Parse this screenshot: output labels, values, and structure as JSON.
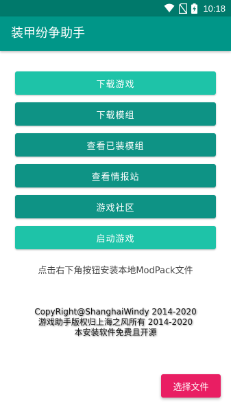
{
  "status_bar": {
    "time": "10:18",
    "icons": [
      "wifi-icon",
      "no-sim-icon",
      "battery-charging-icon"
    ],
    "color": "#00796b"
  },
  "app_bar": {
    "title": "装甲纷争助手",
    "color": "#009688"
  },
  "menu": {
    "download_game": "下载游戏",
    "download_mod": "下载模组",
    "view_installed_mods": "查看已装模组",
    "view_intel_station": "查看情报站",
    "game_community": "游戏社区",
    "launch_game": "启动游戏"
  },
  "hint": "点击右下角按钮安装本地ModPack文件",
  "copyright": {
    "line1": "CopyRight@ShanghaiWindy 2014-2020",
    "line2": "游戏助手版权归上海之风所有 2014-2020",
    "line3": "本安装软件免费且开源"
  },
  "fab": {
    "label": "选择文件",
    "color": "#e91e63"
  },
  "colors": {
    "button_light": "#1ec3a8",
    "button_dark": "#0e9385"
  }
}
